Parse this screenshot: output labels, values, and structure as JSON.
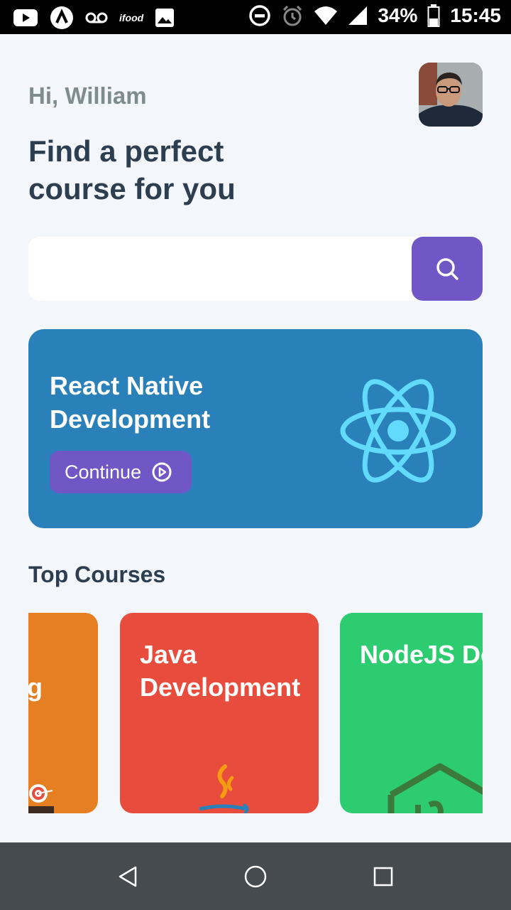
{
  "status_bar": {
    "ifood_label": "ifood",
    "battery": "34%",
    "time": "15:45",
    "icons": [
      "youtube-icon",
      "app-a-icon",
      "voicemail-icon",
      "ifood-icon",
      "gallery-icon",
      "dnd-icon",
      "alarm-icon",
      "wifi-icon",
      "signal-icon",
      "battery-icon"
    ]
  },
  "header": {
    "greeting": "Hi, William",
    "headline": "Find a perfect course for you"
  },
  "search": {
    "placeholder": "",
    "value": ""
  },
  "featured": {
    "title": "React Native Development",
    "button_label": "Continue",
    "color": "#2a80b9",
    "icon": "react-logo-icon"
  },
  "top_courses": {
    "title": "Top Courses",
    "items": [
      {
        "title_visible": "g",
        "color": "#e67e22",
        "icon": "marketing-icon"
      },
      {
        "title": "Java Development",
        "color": "#e74c3c",
        "icon": "java-logo-icon"
      },
      {
        "title": "NodeJS Developme",
        "color": "#2ecc71",
        "icon": "nodejs-logo-icon"
      }
    ]
  },
  "colors": {
    "accent": "#7156c6",
    "text_dark": "#2c3e50",
    "text_muted": "#7f8c8d",
    "background": "#f3f6fb"
  },
  "nav_bar": {
    "icons": [
      "back-icon",
      "home-icon",
      "recents-icon"
    ]
  }
}
